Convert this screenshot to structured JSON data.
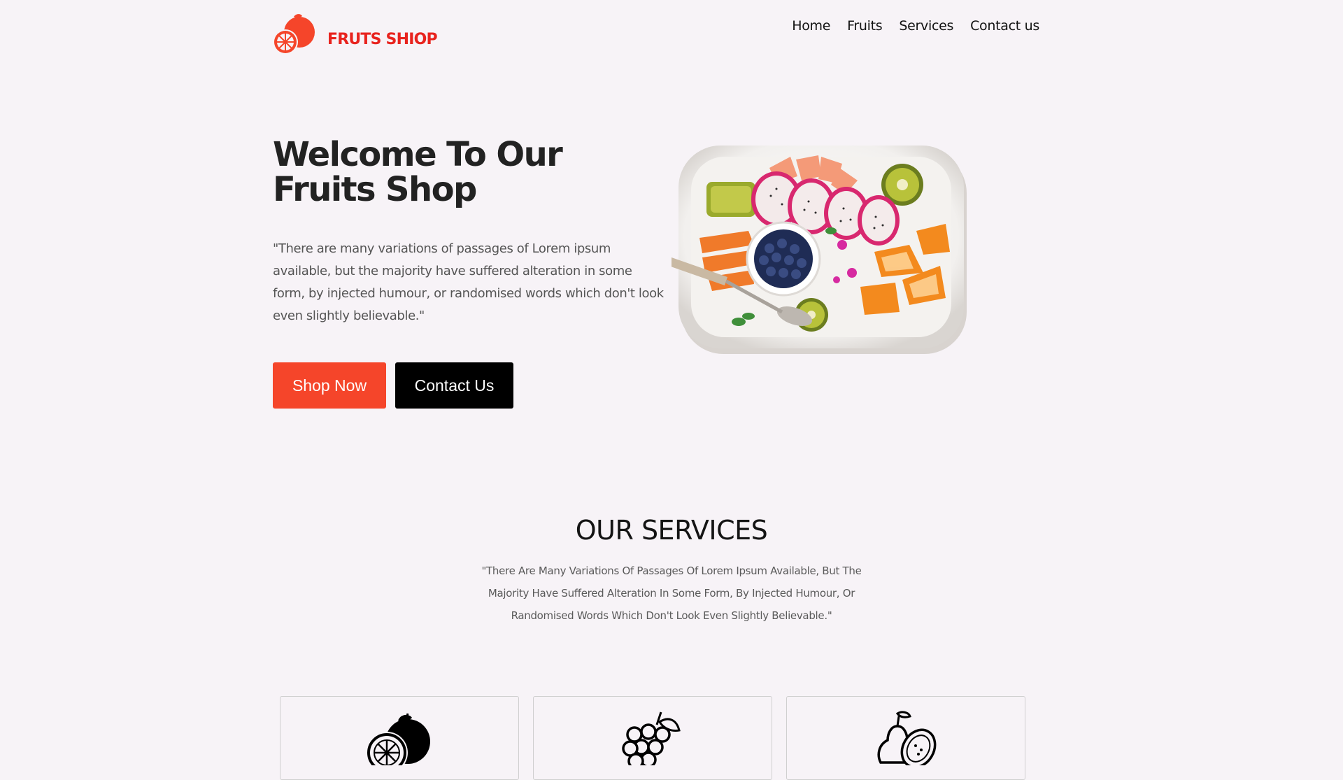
{
  "brand": {
    "name": "FRUTS SHIOP",
    "color": "#e8231e"
  },
  "nav": {
    "items": [
      "Home",
      "Fruits",
      "Services",
      "Contact us"
    ]
  },
  "hero": {
    "title": "Welcome To Our Fruits Shop",
    "description": "\"There are many variations of passages of Lorem ipsum available, but the majority have suffered alteration in some form, by injected humour, or randomised words which don't look even slightly believable.\"",
    "primary_button": "Shop Now",
    "secondary_button": "Contact Us",
    "primary_color": "#f5452a",
    "secondary_color": "#000000"
  },
  "services": {
    "title": "OUR SERVICES",
    "description": "\"There Are Many Variations Of Passages Of Lorem Ipsum Available, But The Majority Have Suffered Alteration In Some Form, By Injected Humour, Or Randomised Words Which Don't Look Even Slightly Believable.\"",
    "cards": [
      {
        "icon": "orange-icon"
      },
      {
        "icon": "grapes-icon"
      },
      {
        "icon": "lemon-pear-icon"
      }
    ]
  }
}
